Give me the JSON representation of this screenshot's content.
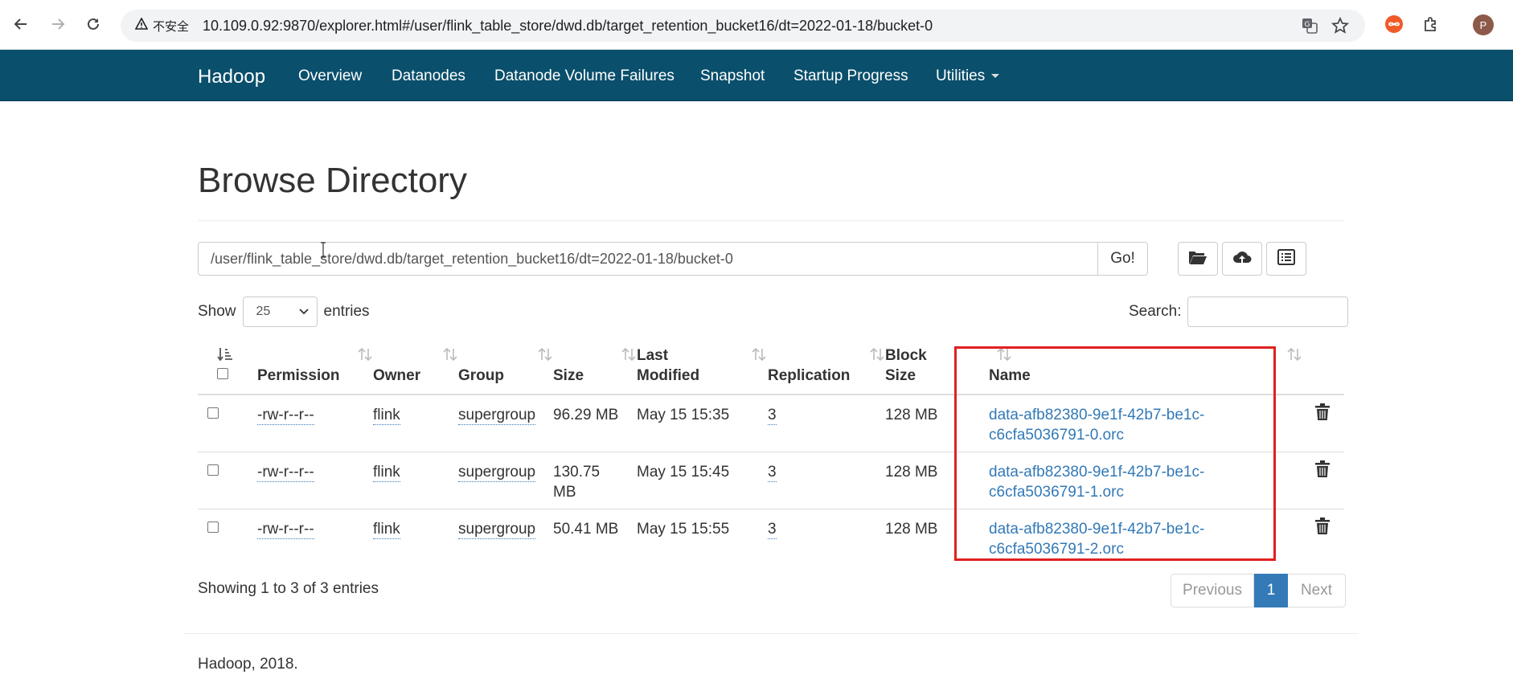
{
  "browser": {
    "security_label": "不安全",
    "url": "10.109.0.92:9870/explorer.html#/user/flink_table_store/dwd.db/target_retention_bucket16/dt=2022-01-18/bucket-0",
    "profile_initial": "P"
  },
  "navbar": {
    "brand": "Hadoop",
    "items": [
      "Overview",
      "Datanodes",
      "Datanode Volume Failures",
      "Snapshot",
      "Startup Progress",
      "Utilities"
    ]
  },
  "page": {
    "title": "Browse Directory",
    "path_value": "/user/flink_table_store/dwd.db/target_retention_bucket16/dt=2022-01-18/bucket-0",
    "go_label": "Go!",
    "tools": [
      "folder-open-icon",
      "cloud-upload-icon",
      "list-alt-icon"
    ]
  },
  "controls": {
    "show_label": "Show",
    "entries_value": "25",
    "entries_label": "entries",
    "search_label": "Search:"
  },
  "table": {
    "headers": {
      "permission": "Permission",
      "owner": "Owner",
      "group": "Group",
      "size": "Size",
      "last_modified_1": "Last",
      "last_modified_2": "Modified",
      "replication": "Replication",
      "block_size_1": "Block",
      "block_size_2": "Size",
      "name": "Name"
    },
    "rows": [
      {
        "permission": "-rw-r--r--",
        "owner": "flink",
        "group": "supergroup",
        "size_1": "96.29 MB",
        "size_2": "",
        "modified": "May 15 15:35",
        "replication": "3",
        "block_size": "128 MB",
        "name_1": "data-afb82380-9e1f-42b7-be1c-",
        "name_2": "c6cfa5036791-0.orc"
      },
      {
        "permission": "-rw-r--r--",
        "owner": "flink",
        "group": "supergroup",
        "size_1": "130.75",
        "size_2": "MB",
        "modified": "May 15 15:45",
        "replication": "3",
        "block_size": "128 MB",
        "name_1": "data-afb82380-9e1f-42b7-be1c-",
        "name_2": "c6cfa5036791-1.orc"
      },
      {
        "permission": "-rw-r--r--",
        "owner": "flink",
        "group": "supergroup",
        "size_1": "50.41 MB",
        "size_2": "",
        "modified": "May 15 15:55",
        "replication": "3",
        "block_size": "128 MB",
        "name_1": "data-afb82380-9e1f-42b7-be1c-",
        "name_2": "c6cfa5036791-2.orc"
      }
    ]
  },
  "footer": {
    "info": "Showing 1 to 3 of 3 entries",
    "previous": "Previous",
    "current_page": "1",
    "next": "Next",
    "copyright": "Hadoop, 2018."
  },
  "colors": {
    "navbar": "#0a4f6b",
    "link": "#3279b7",
    "highlight": "#e02020",
    "pager_active": "#337ab7"
  }
}
